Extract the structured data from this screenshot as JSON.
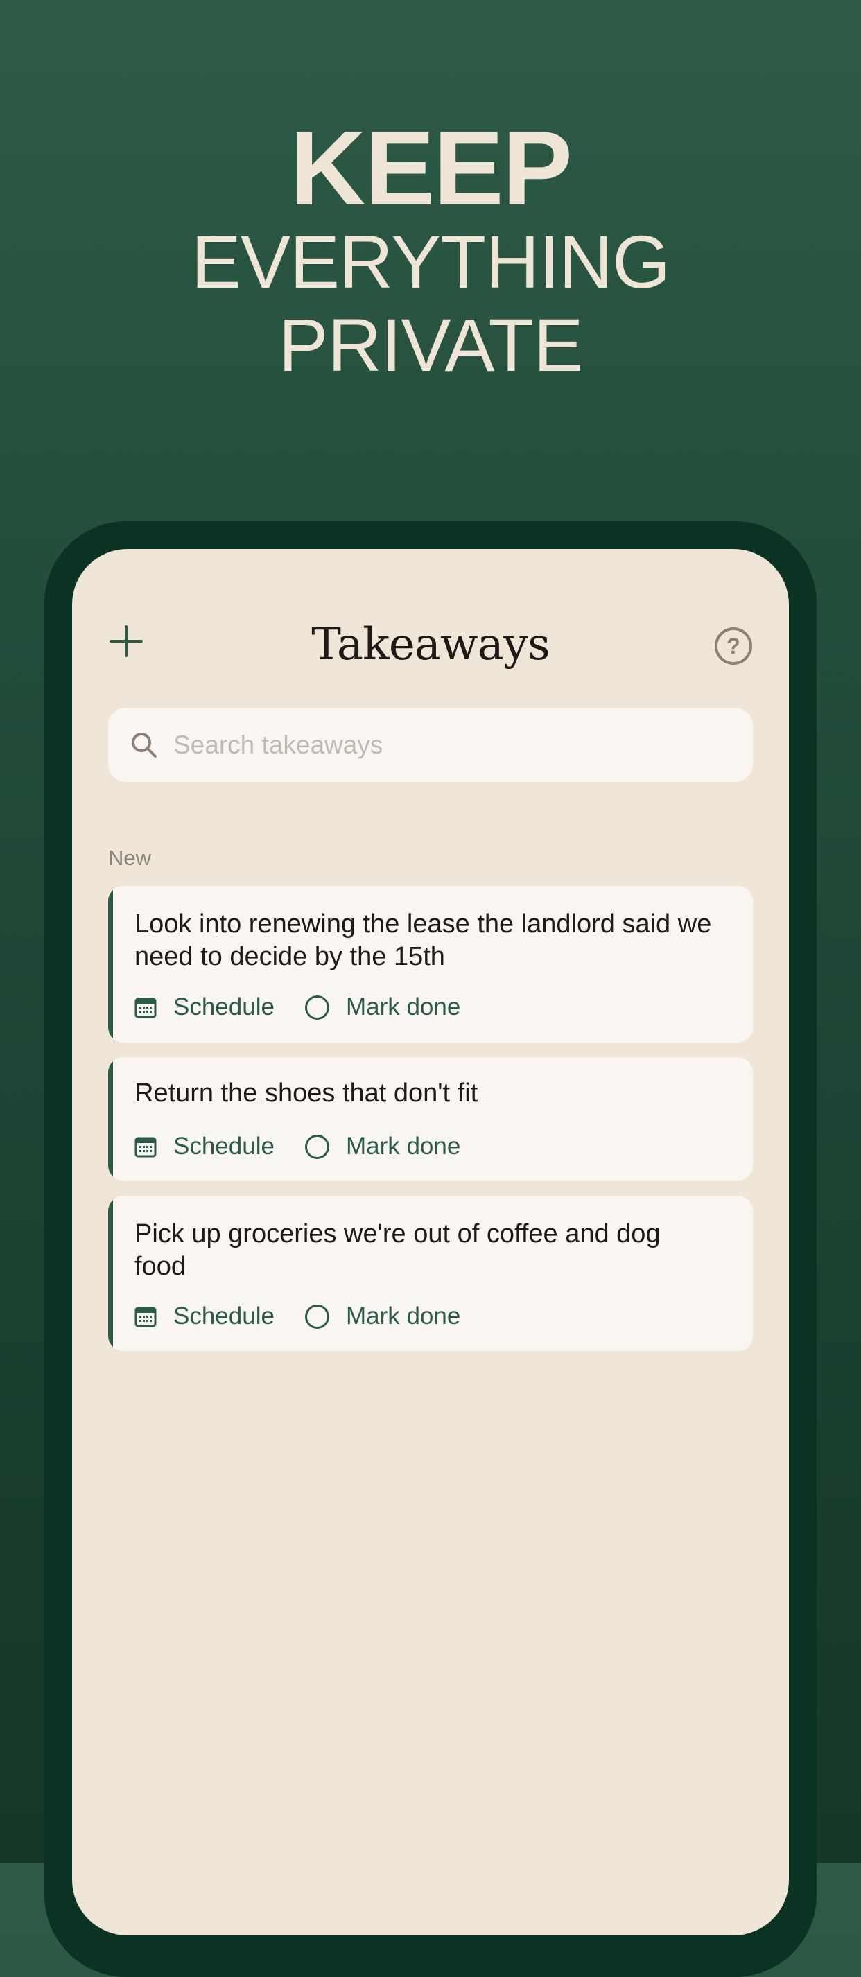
{
  "headline": {
    "line1": "KEEP",
    "line2": "EVERYTHING",
    "line3": "PRIVATE"
  },
  "app": {
    "title": "Takeaways",
    "add_icon": "plus-icon",
    "help_icon": "question-circle-icon",
    "help_glyph": "?"
  },
  "search": {
    "placeholder": "Search takeaways",
    "icon": "search-icon"
  },
  "section": {
    "label": "New"
  },
  "cards": [
    {
      "text": "Look into renewing the lease the landlord said we need to decide by the 15th",
      "schedule_label": "Schedule",
      "done_label": "Mark done"
    },
    {
      "text": "Return the shoes that don't fit",
      "schedule_label": "Schedule",
      "done_label": "Mark done"
    },
    {
      "text": "Pick up groceries we're out of coffee and dog food",
      "schedule_label": "Schedule",
      "done_label": "Mark done"
    }
  ],
  "colors": {
    "background": "#2d5b47",
    "accent": "#2a5c44",
    "headline_text": "#efe5d6",
    "screen": "#efe6d8",
    "card": "#f9f6f1"
  }
}
